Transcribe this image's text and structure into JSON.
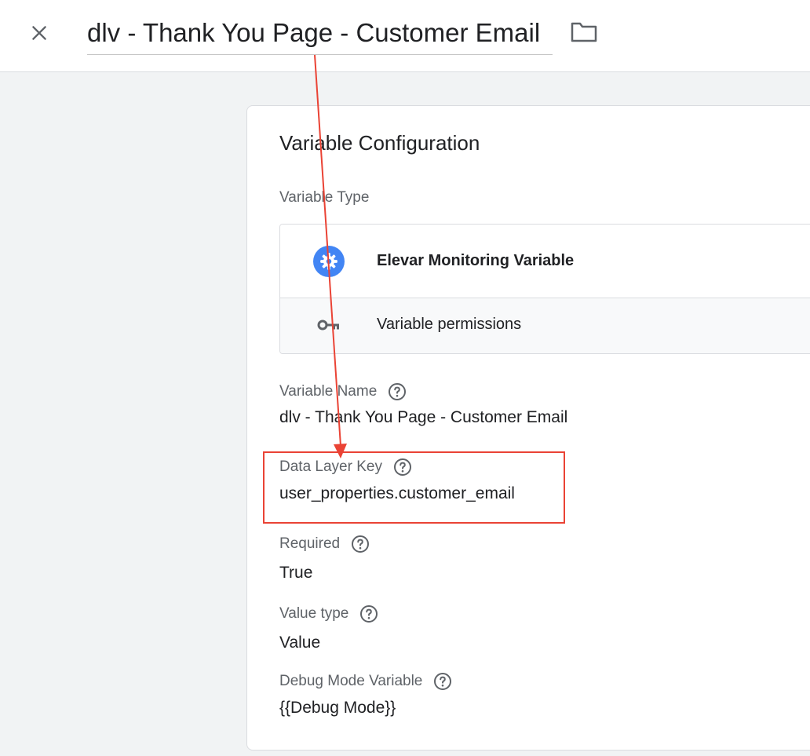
{
  "header": {
    "title_value": "dlv - Thank You Page - Customer Email"
  },
  "config": {
    "title": "Variable Configuration",
    "variable_type_label": "Variable Type",
    "variable_type_name": "Elevar Monitoring Variable",
    "variable_permissions_label": "Variable permissions",
    "fields": {
      "variable_name": {
        "label": "Variable Name",
        "value": "dlv - Thank You Page - Customer Email"
      },
      "data_layer_key": {
        "label": "Data Layer Key",
        "value": "user_properties.customer_email"
      },
      "required": {
        "label": "Required",
        "value": "True"
      },
      "value_type": {
        "label": "Value type",
        "value": "Value"
      },
      "debug_mode_variable": {
        "label": "Debug Mode Variable",
        "value": "{{Debug Mode}}"
      }
    }
  },
  "icons": {
    "close": "close-icon",
    "folder": "folder-icon",
    "variable_type": "gear-icon",
    "permissions": "key-icon",
    "help": "help-circle-icon"
  },
  "colors": {
    "accent_blue": "#4285f4",
    "annotation_red": "#ea4335"
  }
}
